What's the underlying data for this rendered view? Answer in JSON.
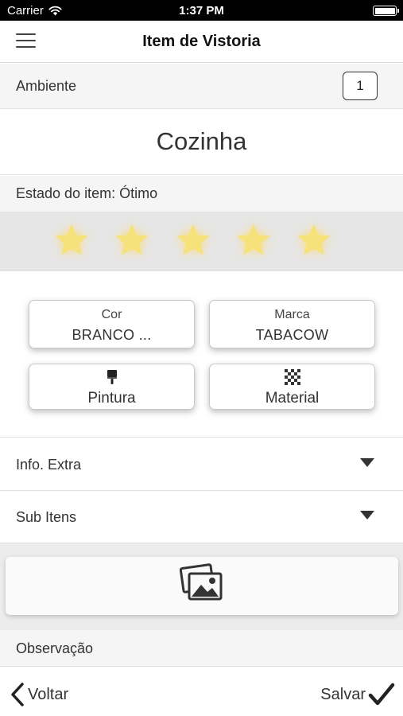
{
  "status_bar": {
    "carrier": "Carrier",
    "time": "1:37 PM",
    "wifi_icon": "wifi-icon",
    "battery_icon": "battery-icon"
  },
  "nav": {
    "title": "Item de Vistoria",
    "menu_icon": "hamburger-menu-icon"
  },
  "ambiente": {
    "label": "Ambiente",
    "number": "1"
  },
  "room": {
    "name": "Cozinha"
  },
  "estado": {
    "label": "Estado do item: Ótimo",
    "rating": 5,
    "max_rating": 5,
    "star_color": "#f5e27a"
  },
  "properties": {
    "cor": {
      "label": "Cor",
      "value": "BRANCO ..."
    },
    "marca": {
      "label": "Marca",
      "value": "TABACOW"
    },
    "pintura": {
      "label": "Pintura",
      "icon": "paint-brush-icon"
    },
    "material": {
      "label": "Material",
      "icon": "checkered-texture-icon"
    }
  },
  "sections": {
    "info_extra": "Info. Extra",
    "sub_itens": "Sub Itens"
  },
  "photos": {
    "icon": "image-gallery-icon"
  },
  "observacao": {
    "label": "Observação"
  },
  "bottom": {
    "back_label": "Voltar",
    "save_label": "Salvar"
  }
}
